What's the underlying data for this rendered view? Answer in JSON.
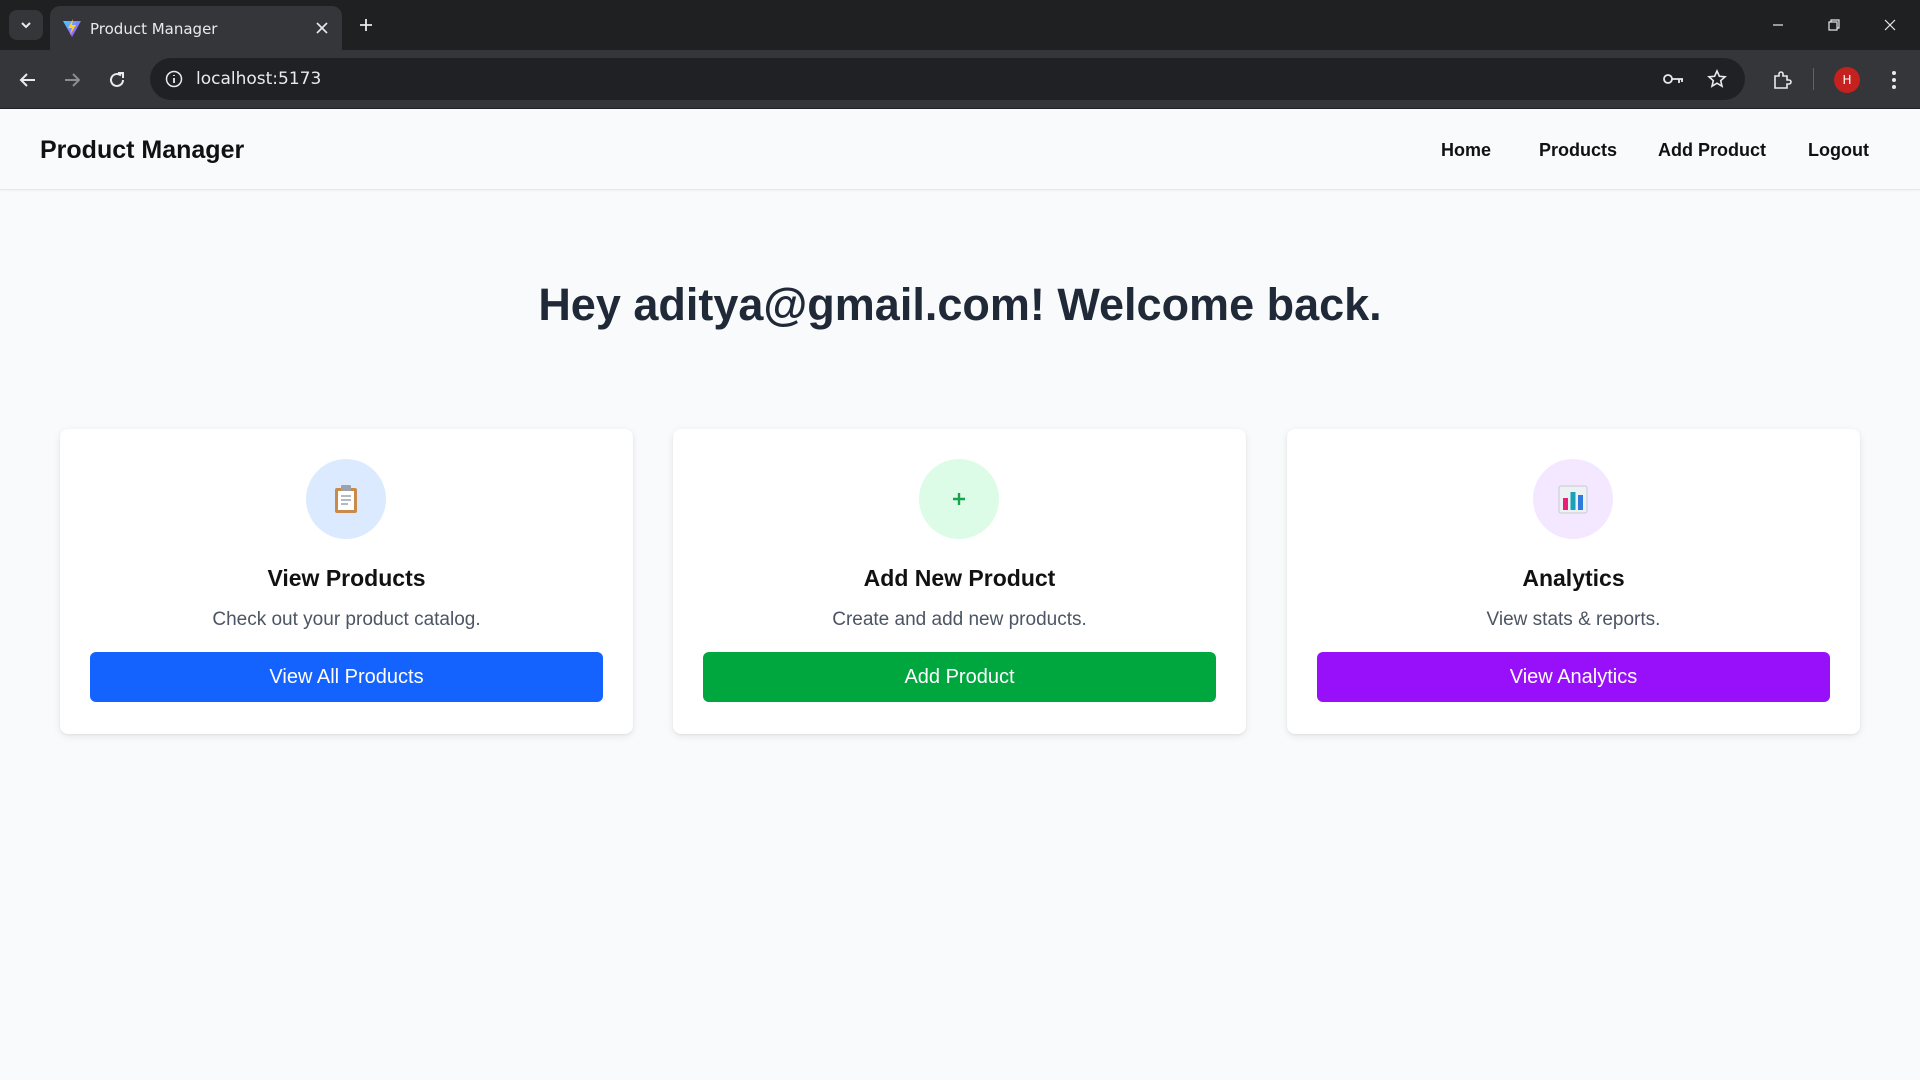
{
  "browser": {
    "tab_title": "Product Manager",
    "url": "localhost:5173",
    "profile_initial": "H"
  },
  "app": {
    "brand": "Product Manager",
    "nav": [
      "Home",
      "Products",
      "Add Product",
      "Logout"
    ]
  },
  "welcome": "Hey aditya@gmail.com! Welcome back.",
  "cards": [
    {
      "icon": "clipboard-icon",
      "title": "View Products",
      "description": "Check out your product catalog.",
      "button": "View All Products",
      "button_color": "#1463ff",
      "icon_bg": "#dbeafe"
    },
    {
      "icon": "plus-icon",
      "title": "Add New Product",
      "description": "Create and add new products.",
      "button": "Add Product",
      "button_color": "#00a63e",
      "icon_bg": "#dcfce7"
    },
    {
      "icon": "bar-chart-icon",
      "title": "Analytics",
      "description": "View stats & reports.",
      "button": "View Analytics",
      "button_color": "#9810fa",
      "icon_bg": "#f3e8ff"
    }
  ]
}
